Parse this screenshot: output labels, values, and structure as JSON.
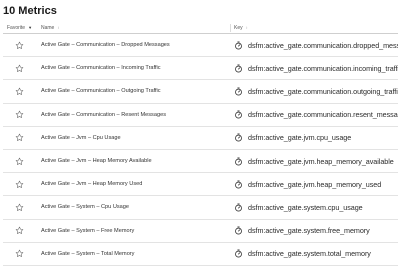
{
  "page": {
    "title": "10 Metrics"
  },
  "table": {
    "columns": {
      "favorite": "Favorite",
      "name": "Name",
      "key": "Key"
    },
    "icons": {
      "favorite_sort": "sort-descending-icon",
      "name_sort": "sort-icon",
      "key_sort": "sort-icon",
      "row_favorite": "star-outline-icon",
      "row_metric": "stopwatch-icon"
    },
    "rows": [
      {
        "name": "Active Gate – Communication – Dropped Messages",
        "key": "dsfm:active_gate.communication.dropped_messages"
      },
      {
        "name": "Active Gate – Communication – Incoming Traffic",
        "key": "dsfm:active_gate.communication.incoming_traffic"
      },
      {
        "name": "Active Gate – Communication – Outgoing Traffic",
        "key": "dsfm:active_gate.communication.outgoing_traffic"
      },
      {
        "name": "Active Gate – Communication – Resent Messages",
        "key": "dsfm:active_gate.communication.resent_messages"
      },
      {
        "name": "Active Gate – Jvm – Cpu Usage",
        "key": "dsfm:active_gate.jvm.cpu_usage"
      },
      {
        "name": "Active Gate – Jvm – Heap Memory Available",
        "key": "dsfm:active_gate.jvm.heap_memory_available"
      },
      {
        "name": "Active Gate – Jvm – Heap Memory Used",
        "key": "dsfm:active_gate.jvm.heap_memory_used"
      },
      {
        "name": "Active Gate – System – Cpu Usage",
        "key": "dsfm:active_gate.system.cpu_usage"
      },
      {
        "name": "Active Gate – System – Free Memory",
        "key": "dsfm:active_gate.system.free_memory"
      },
      {
        "name": "Active Gate – System – Total Memory",
        "key": "dsfm:active_gate.system.total_memory"
      }
    ]
  },
  "colors": {
    "text": "#333333",
    "border": "#e3e3e3",
    "icon": "#555555"
  }
}
